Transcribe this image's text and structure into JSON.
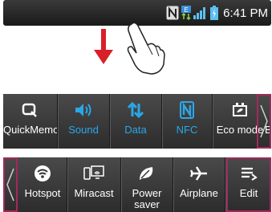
{
  "status_bar": {
    "time": "6:41 PM",
    "icons": [
      "nfc-icon",
      "data-transfer-icon",
      "signal-icon",
      "battery-icon"
    ]
  },
  "gesture": {
    "arrow": "down-arrow-icon",
    "hand": "swipe-hand-icon"
  },
  "panel1": {
    "tiles": [
      {
        "label": "QuickMemo",
        "icon": "quickmemo-icon",
        "active": false
      },
      {
        "label": "Sound",
        "icon": "sound-icon",
        "active": true
      },
      {
        "label": "Data",
        "icon": "data-icon",
        "active": true
      },
      {
        "label": "NFC",
        "icon": "nfc-icon",
        "active": true
      },
      {
        "label": "Eco mode",
        "icon": "eco-mode-icon",
        "active": false
      },
      {
        "label": "B",
        "icon": "",
        "active": false
      }
    ],
    "scroll_right": "chevron-right-icon"
  },
  "panel2": {
    "scroll_left": "chevron-left-icon",
    "tiles": [
      {
        "label": "Hotspot",
        "icon": "hotspot-icon"
      },
      {
        "label": "Miracast",
        "icon": "miracast-icon"
      },
      {
        "label": "Power saver",
        "icon": "power-saver-icon"
      },
      {
        "label": "Airplane",
        "icon": "airplane-icon"
      },
      {
        "label": "Edit",
        "icon": "edit-icon"
      }
    ]
  },
  "colors": {
    "active_label": "#29a8e8",
    "inactive_label": "#ffffff",
    "highlight_border": "#a22a5a"
  }
}
